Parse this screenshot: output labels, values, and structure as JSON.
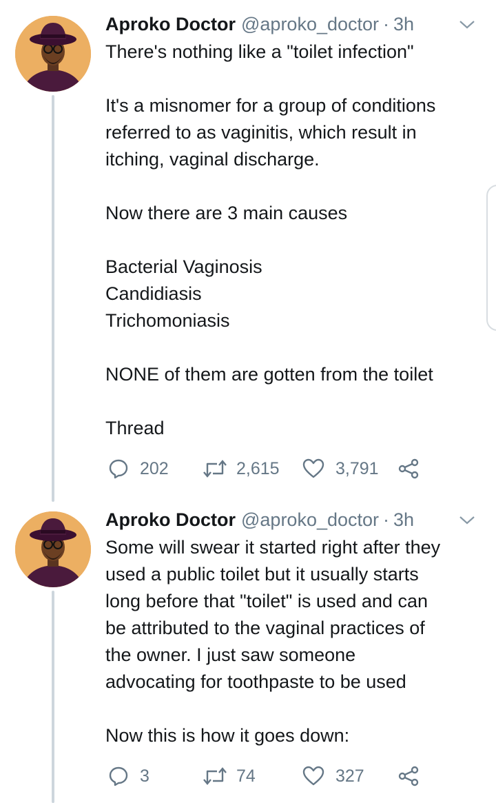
{
  "tweets": [
    {
      "name": "Aproko Doctor",
      "handle": "@aproko_doctor",
      "dot": "·",
      "time": "3h",
      "lines": [
        "There's nothing like a \"toilet infection\"",
        "",
        "It's a misnomer for a group of conditions",
        "referred to as vaginitis, which result in",
        "itching, vaginal discharge.",
        "",
        "Now there are 3 main causes",
        "",
        "Bacterial Vaginosis",
        "Candidiasis",
        "Trichomoniasis",
        "",
        "NONE of them are gotten from the toilet",
        "",
        "Thread"
      ],
      "replies": "202",
      "retweets": "2,615",
      "likes": "3,791"
    },
    {
      "name": "Aproko Doctor",
      "handle": "@aproko_doctor",
      "dot": "·",
      "time": "3h",
      "lines": [
        "Some will swear it started right after they",
        "used a public toilet but it usually starts",
        "long before that \"toilet\" is used and can",
        "be attributed to the vaginal practices of",
        "the owner. I just saw someone",
        "advocating for toothpaste to be used",
        "",
        "Now this is how it goes down:"
      ],
      "replies": "3",
      "retweets": "74",
      "likes": "327"
    }
  ],
  "icons": {
    "reply": "reply-icon",
    "retweet": "retweet-icon",
    "like": "heart-icon",
    "share": "share-icon",
    "menu": "chevron-down-icon"
  },
  "colors": {
    "text": "#14171a",
    "muted": "#657786",
    "thread_line": "#cdd6dd",
    "avatar_bg": "#e9a85a"
  }
}
